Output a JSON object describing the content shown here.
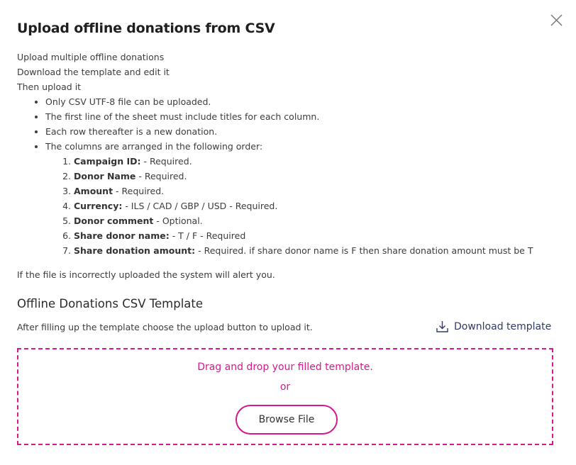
{
  "dialog": {
    "title": "Upload offline donations from CSV",
    "close_icon": "close-icon",
    "intro": [
      "Upload multiple offline donations",
      "Download the template and edit it",
      "Then upload it"
    ],
    "bullets": [
      "Only CSV UTF-8 file can be uploaded.",
      "The first line of the sheet must include titles for each column.",
      "Each row thereafter is a new donation.",
      "The columns are arranged in the following order:"
    ],
    "columns": [
      {
        "name": "Campaign ID:",
        "desc": " - Required."
      },
      {
        "name": "Donor Name",
        "desc": " - Required."
      },
      {
        "name": "Amount",
        "desc": " - Required."
      },
      {
        "name": "Currency:",
        "desc": " - ILS / CAD / GBP / USD - Required."
      },
      {
        "name": "Donor comment",
        "desc": " - Optional."
      },
      {
        "name": "Share donor name:",
        "desc": " - T / F - Required"
      },
      {
        "name": "Share donation amount:",
        "desc": " - Required. if share donor name is F then share donation amount must be T"
      }
    ],
    "note": "If the file is incorrectly uploaded the system will alert you.",
    "template_section": {
      "title": "Offline Donations CSV Template",
      "subtitle": "After filling up the template choose the upload button to upload it.",
      "download_label": "Download template",
      "download_icon": "download-icon"
    },
    "dropzone": {
      "line1": "Drag and drop your filled template.",
      "line2": "or",
      "browse_label": "Browse File"
    },
    "colors": {
      "accent": "#d6198f",
      "link": "#2f3a66",
      "text": "#3c3c3c"
    }
  }
}
